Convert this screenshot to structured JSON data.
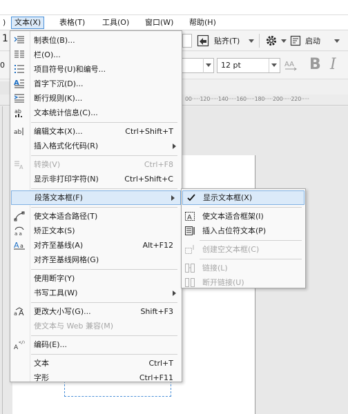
{
  "menubar": {
    "partial_left": ")",
    "items": [
      {
        "label": "文本(X)",
        "active": true
      },
      {
        "label": "表格(T)"
      },
      {
        "label": "工具(O)"
      },
      {
        "label": "窗口(W)"
      },
      {
        "label": "帮助(H)"
      }
    ]
  },
  "toolbar": {
    "snap_label": "贴齐(T)",
    "launch_label": "启动",
    "partial_left": "1"
  },
  "propbar": {
    "font_size": "12 pt",
    "partial_left": "0"
  },
  "ruler": {
    "ticks_text": "00·····120·····140·····160·····180·····200·····220·····"
  },
  "text_menu": {
    "items": [
      {
        "label": "制表位(B)...",
        "icon": "tab-stops-icon"
      },
      {
        "label": "栏(O)...",
        "icon": "columns-icon"
      },
      {
        "label": "项目符号(U)和编号...",
        "icon": "bullets-icon"
      },
      {
        "label": "首字下沉(D)...",
        "icon": "drop-cap-icon"
      },
      {
        "label": "断行规则(K)...",
        "icon": "line-break-rules-icon"
      },
      {
        "label": "文本统计信息(C)...",
        "icon": "text-statistics-icon"
      },
      {
        "label": "编辑文本(X)...",
        "shortcut": "Ctrl+Shift+T",
        "icon": "edit-text-icon"
      },
      {
        "label": "插入格式化代码(R)"
      },
      {
        "label": "转换(V)",
        "shortcut": "Ctrl+F8",
        "icon": "convert-icon"
      },
      {
        "label": "显示非打印字符(N)",
        "shortcut": "Ctrl+Shift+C"
      },
      {
        "label": "段落文本框(F)"
      },
      {
        "label": "使文本适合路径(T)",
        "icon": "fit-text-to-path-icon"
      },
      {
        "label": "矫正文本(S)",
        "icon": "straighten-text-icon"
      },
      {
        "label": "对齐至基线(A)",
        "shortcut": "Alt+F12",
        "icon": "align-baseline-icon"
      },
      {
        "label": "对齐至基线网格(G)"
      },
      {
        "label": "使用断字(Y)"
      },
      {
        "label": "书写工具(W)"
      },
      {
        "label": "更改大小写(G)...",
        "shortcut": "Shift+F3",
        "icon": "change-case-icon"
      },
      {
        "label": "使文本与 Web 兼容(M)"
      },
      {
        "label": "编码(E)...",
        "icon": "encode-icon"
      },
      {
        "label": "文本",
        "shortcut": "Ctrl+T"
      },
      {
        "label": "字形",
        "shortcut": "Ctrl+F11"
      }
    ]
  },
  "paragraph_submenu": {
    "items": [
      {
        "label": "显示文本框(X)",
        "icon": "checkmark-icon"
      },
      {
        "label": "使文本适合框架(I)",
        "icon": "fit-text-frame-icon"
      },
      {
        "label": "插入占位符文本(P)",
        "icon": "placeholder-text-icon"
      },
      {
        "label": "创建空文本框(C)",
        "icon": "create-empty-frame-icon"
      },
      {
        "label": "链接(L)",
        "icon": "link-icon"
      },
      {
        "label": "断开链接(U)",
        "icon": "unlink-icon"
      }
    ]
  }
}
